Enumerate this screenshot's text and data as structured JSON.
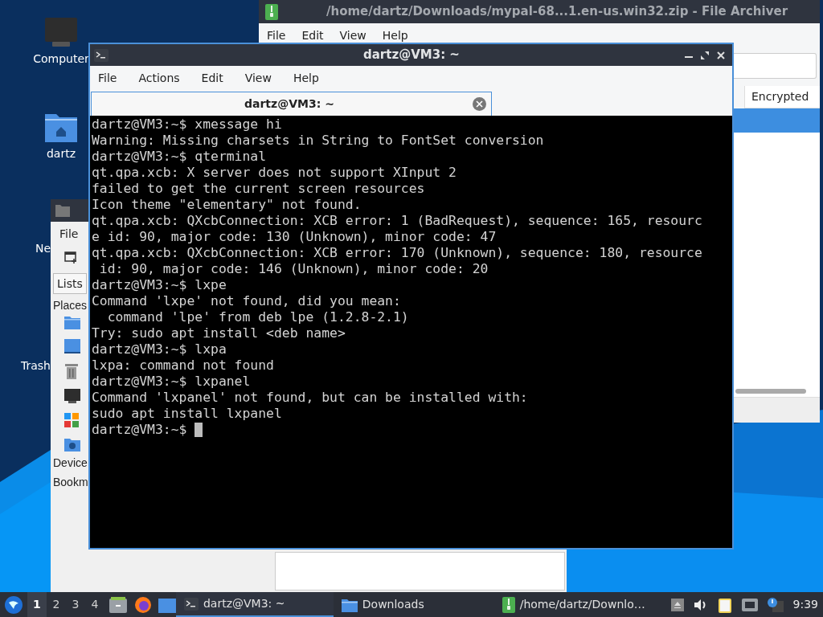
{
  "desktop_icons": [
    {
      "label": "Computer",
      "kind": "computer"
    },
    {
      "label": "dartz",
      "kind": "home"
    },
    {
      "label": "Ne",
      "kind": "hidden"
    },
    {
      "label": "Trash",
      "kind": "hidden"
    }
  ],
  "archiver": {
    "title": "/home/dartz/Downloads/mypal-68...1.en-us.win32.zip - File Archiver",
    "menu": [
      "File",
      "Edit",
      "View",
      "Help"
    ],
    "column": "Encrypted"
  },
  "file_manager": {
    "menu": [
      "File"
    ],
    "side_tab": "Lists",
    "sections": [
      {
        "label": "Places"
      },
      {
        "label": "Device"
      },
      {
        "label": "Bookm"
      }
    ]
  },
  "terminal": {
    "title": "dartz@VM3: ~",
    "menu": [
      "File",
      "Actions",
      "Edit",
      "View",
      "Help"
    ],
    "tab": "dartz@VM3: ~",
    "lines": [
      "dartz@VM3:~$ xmessage hi",
      "Warning: Missing charsets in String to FontSet conversion",
      "dartz@VM3:~$ qterminal",
      "qt.qpa.xcb: X server does not support XInput 2",
      "failed to get the current screen resources",
      "Icon theme \"elementary\" not found.",
      "qt.qpa.xcb: QXcbConnection: XCB error: 1 (BadRequest), sequence: 165, resourc",
      "e id: 90, major code: 130 (Unknown), minor code: 47",
      "qt.qpa.xcb: QXcbConnection: XCB error: 170 (Unknown), sequence: 180, resource",
      " id: 90, major code: 146 (Unknown), minor code: 20",
      "dartz@VM3:~$ lxpe",
      "Command 'lxpe' not found, did you mean:",
      "  command 'lpe' from deb lpe (1.2.8-2.1)",
      "Try: sudo apt install <deb name>",
      "dartz@VM3:~$ lxpa",
      "lxpa: command not found",
      "dartz@VM3:~$ lxpanel",
      "Command 'lxpanel' not found, but can be installed with:",
      "sudo apt install lxpanel",
      "dartz@VM3:~$"
    ]
  },
  "taskbar": {
    "workspaces": [
      {
        "label": "1",
        "selected": true
      },
      {
        "label": "2",
        "selected": false
      },
      {
        "label": "3",
        "selected": false
      },
      {
        "label": "4",
        "selected": false
      }
    ],
    "tasks": [
      {
        "label": "dartz@VM3: ~",
        "kind": "terminal",
        "selected": true
      },
      {
        "label": "Downloads",
        "kind": "folder",
        "selected": false
      },
      {
        "label": "/home/dartz/Downlo…",
        "kind": "archive",
        "selected": false
      }
    ],
    "clock": "9:39"
  }
}
